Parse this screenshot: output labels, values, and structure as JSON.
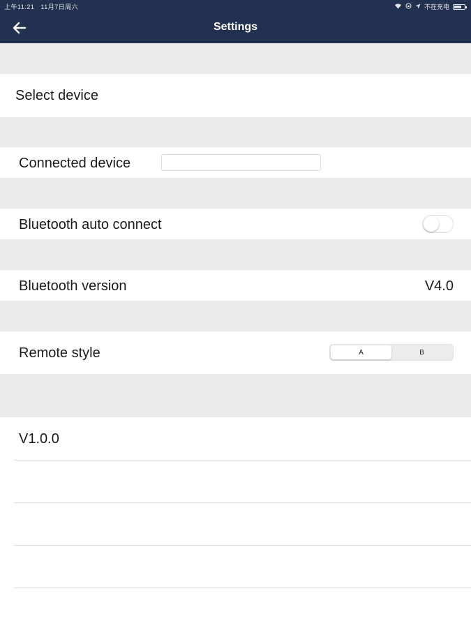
{
  "status_bar": {
    "time": "上午11:21",
    "date": "11月7日周六",
    "wifi_icon": "wifi-icon",
    "lock_icon": "rotation-lock-icon",
    "location_icon": "location-arrow-icon",
    "charging": "不在充电",
    "battery_icon": "battery-icon"
  },
  "header": {
    "back_icon": "arrow-left-icon",
    "title": "Settings",
    "background": "#233150"
  },
  "rows": {
    "select_device": {
      "label": "Select device"
    },
    "connected_device": {
      "label": "Connected device",
      "value": ""
    },
    "bluetooth_auto_connect": {
      "label": "Bluetooth auto connect",
      "enabled": false
    },
    "bluetooth_version": {
      "label": "Bluetooth version",
      "value": "V4.0"
    },
    "remote_style": {
      "label": "Remote style",
      "options": [
        "A",
        "B"
      ],
      "selected": "A"
    },
    "app_version": {
      "label": "V1.0.0"
    }
  }
}
